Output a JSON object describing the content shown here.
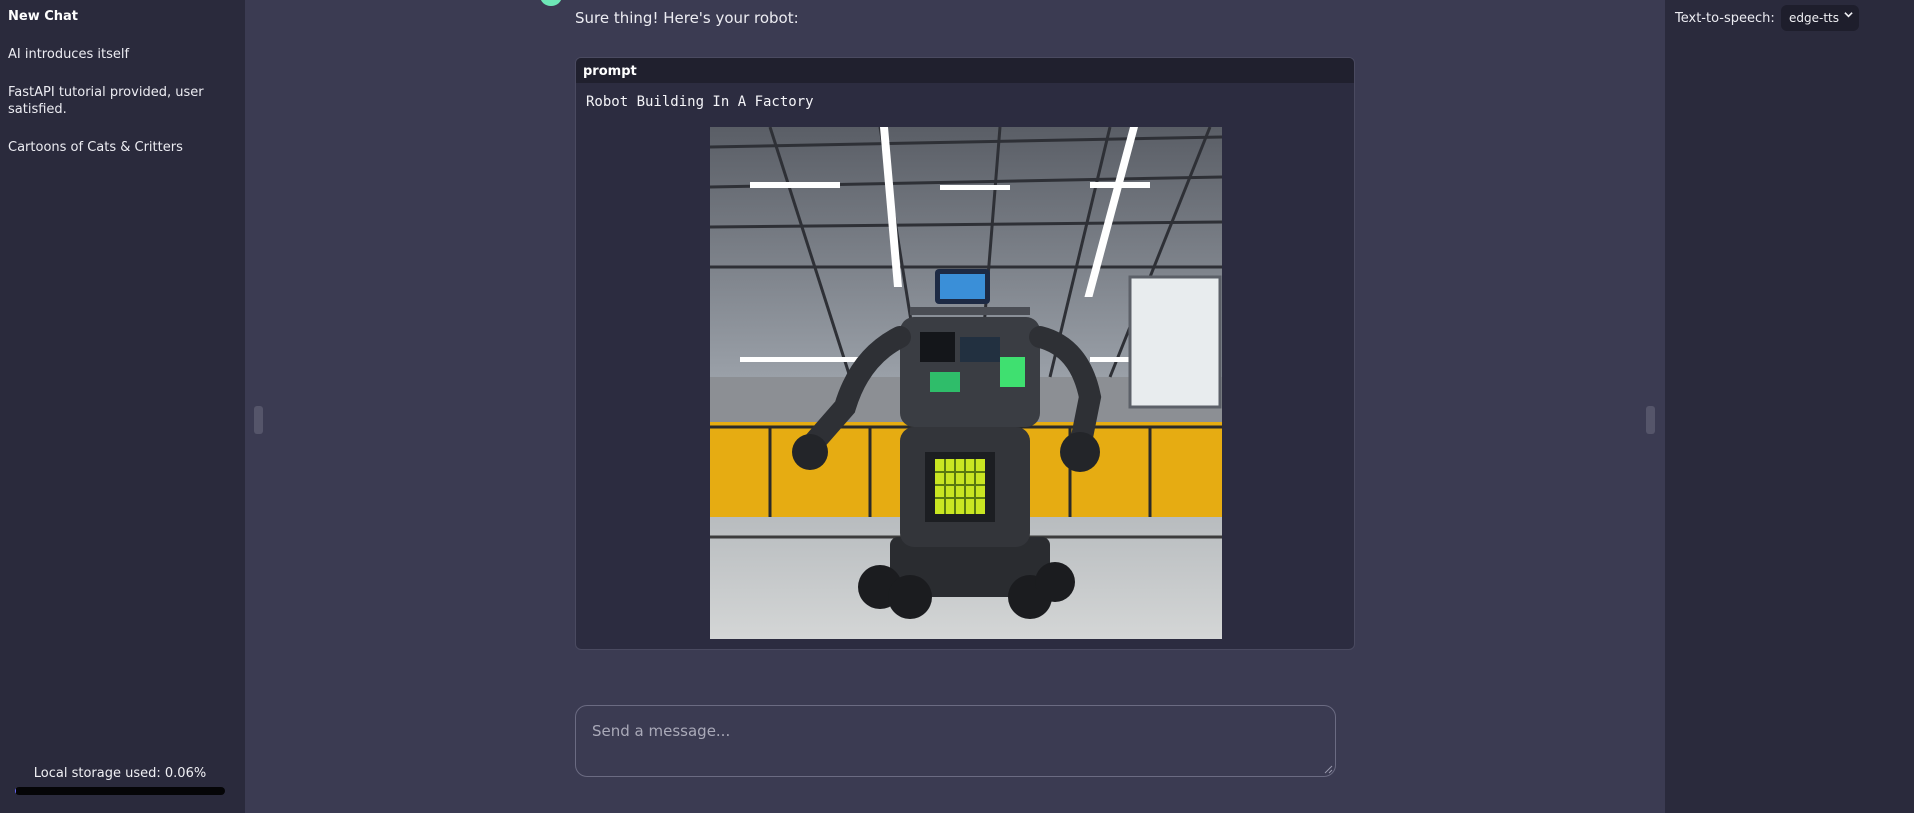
{
  "sidebar": {
    "items": [
      {
        "label": "New Chat",
        "active": true
      },
      {
        "label": "AI introduces itself"
      },
      {
        "label": "FastAPI tutorial provided, user satisfied."
      },
      {
        "label": "Cartoons of Cats & Critters"
      }
    ],
    "storage_label": "Local storage used: 0.06%",
    "storage_used_percent": 0.06
  },
  "right_panel": {
    "tts_label": "Text-to-speech:",
    "tts_value": "edge-tts"
  },
  "chat": {
    "reply_text": "Sure thing! Here's your robot:",
    "code_header": "prompt",
    "prompt_text": "Robot Building In A Factory"
  },
  "composer": {
    "placeholder": "Send a message..."
  },
  "colors": {
    "accent": "#6ee7b7",
    "factory_yellow": "#e6ac12"
  }
}
